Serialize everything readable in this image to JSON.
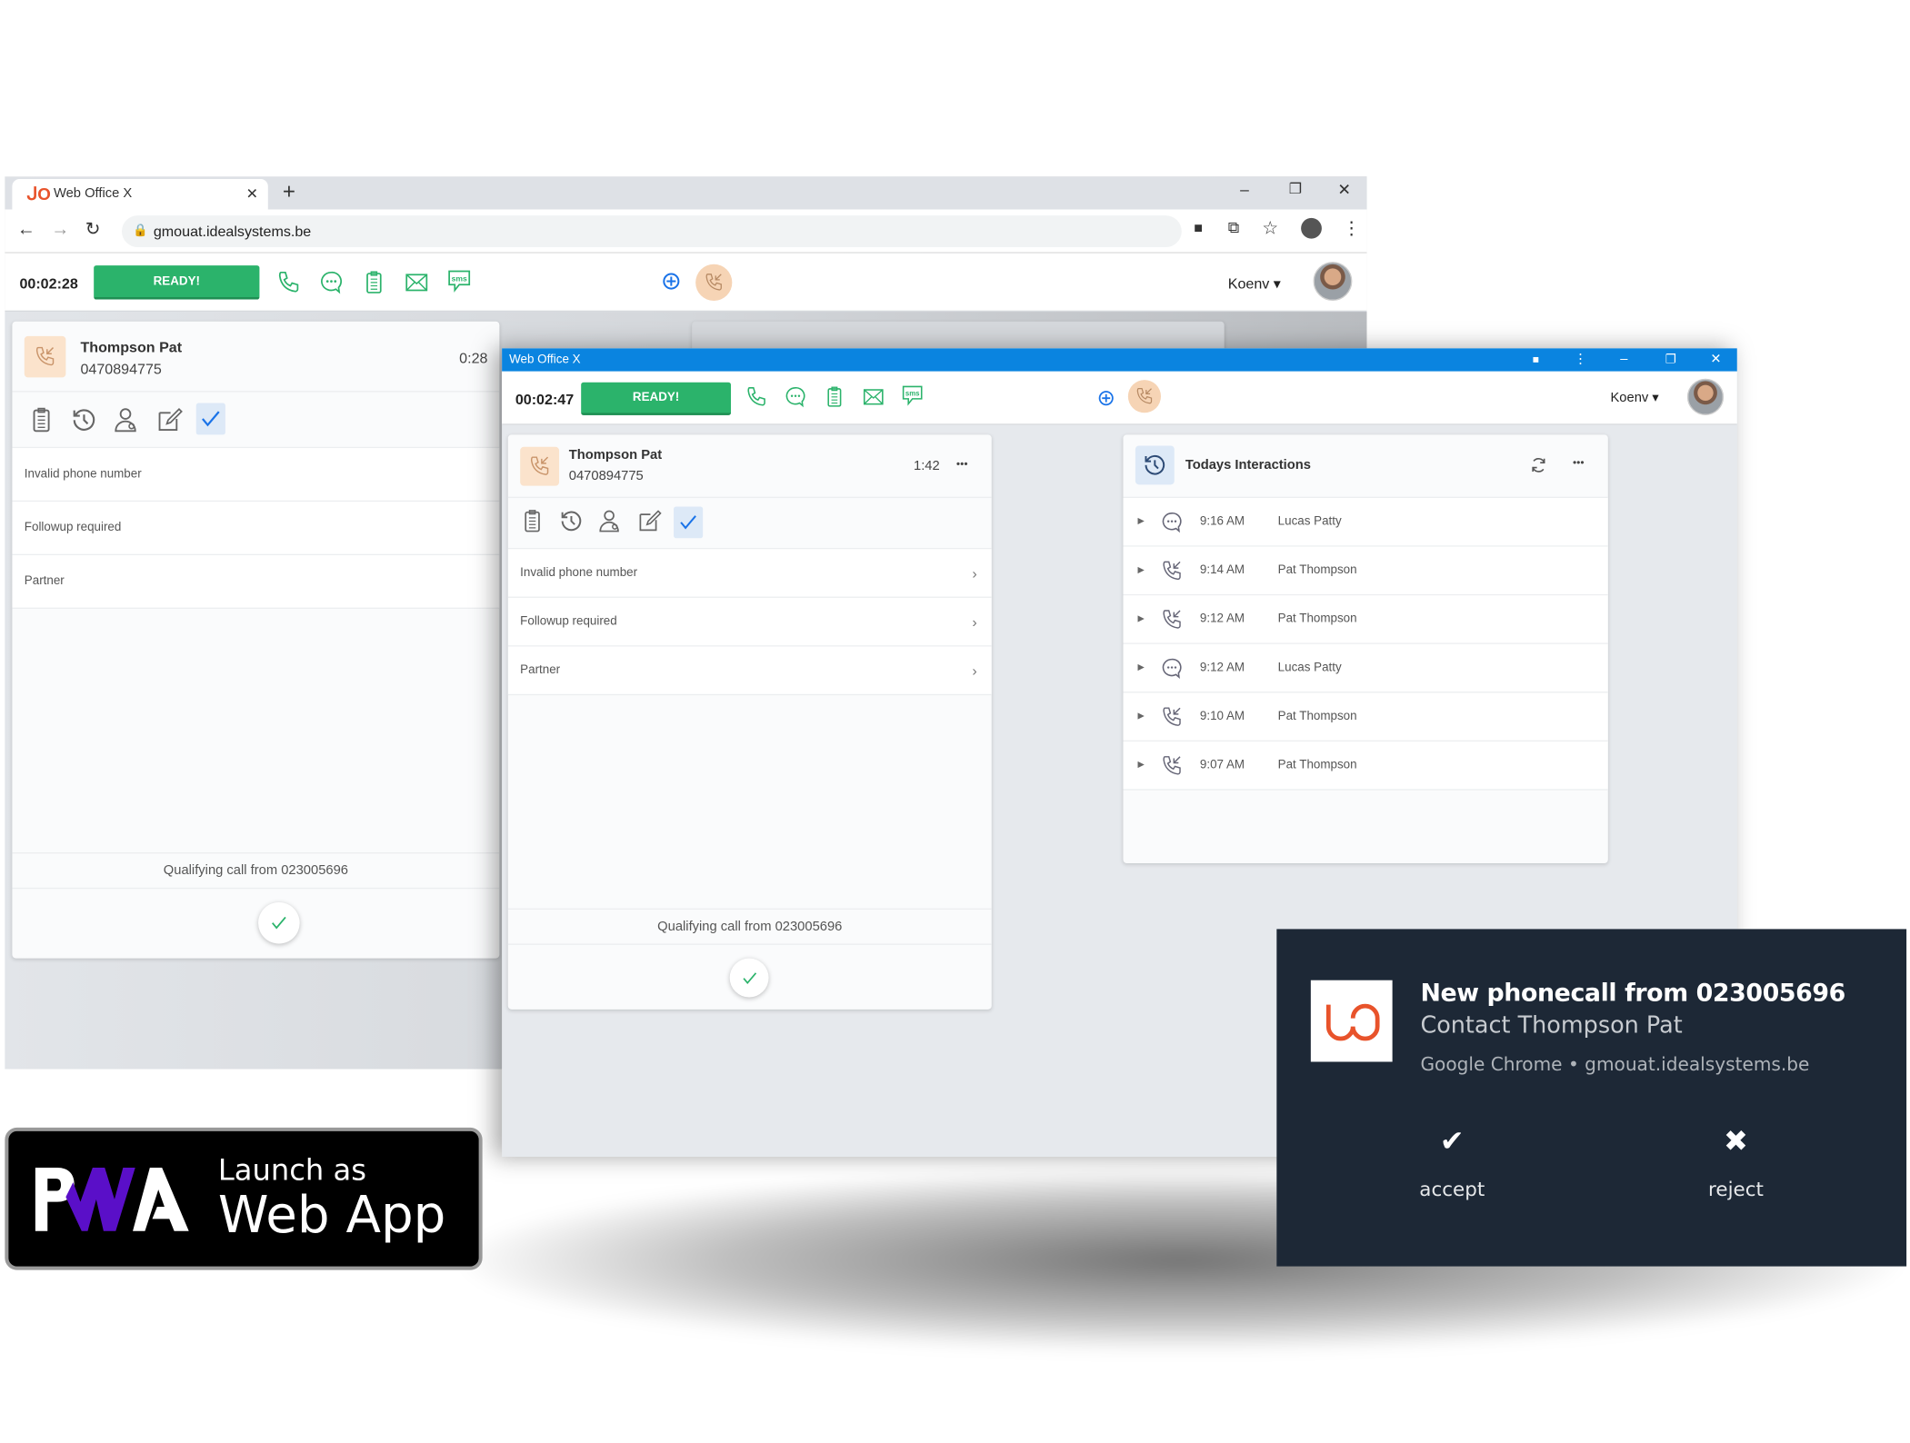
{
  "colors": {
    "ready_green": "#2bb36b",
    "titlebar_blue": "#0a84e0",
    "contact_peach": "#fbe3cc",
    "notification_bg": "#1d2836",
    "brand_orange": "#e8532b",
    "pwa_purple": "#5a0fc8"
  },
  "browser": {
    "tab_title": "Web Office X",
    "new_tab": "+",
    "url": "gmouat.idealsystems.be",
    "window_controls": {
      "minimize": "–",
      "restore": "❐",
      "close": "✕"
    }
  },
  "back_app": {
    "timer": "00:02:28",
    "ready_label": "READY!",
    "user": "Koenv",
    "contact": {
      "name": "Thompson Pat",
      "number": "0470894775",
      "duration": "0:28"
    },
    "options": [
      "Invalid phone number",
      "Followup required",
      "Partner"
    ],
    "footer": "Qualifying call from 023005696"
  },
  "pwa_window": {
    "title": "Web Office X",
    "timer": "00:02:47",
    "ready_label": "READY!",
    "user": "Koenv",
    "contact": {
      "name": "Thompson Pat",
      "number": "0470894775",
      "duration": "1:42",
      "more": "•••"
    },
    "options": [
      "Invalid phone number",
      "Followup required",
      "Partner"
    ],
    "footer": "Qualifying call from 023005696",
    "interactions": {
      "title": "Todays Interactions",
      "more": "•••",
      "rows": [
        {
          "type": "chat",
          "icon": "chat-icon",
          "time": "9:16 AM",
          "name": "Lucas Patty"
        },
        {
          "type": "call",
          "icon": "incoming-call-icon",
          "time": "9:14 AM",
          "name": "Pat Thompson"
        },
        {
          "type": "call",
          "icon": "incoming-call-icon",
          "time": "9:12 AM",
          "name": "Pat Thompson"
        },
        {
          "type": "chat",
          "icon": "chat-icon",
          "time": "9:12 AM",
          "name": "Lucas Patty"
        },
        {
          "type": "call",
          "icon": "incoming-call-icon",
          "time": "9:10 AM",
          "name": "Pat Thompson"
        },
        {
          "type": "call",
          "icon": "incoming-call-icon",
          "time": "9:07 AM",
          "name": "Pat Thompson"
        }
      ]
    }
  },
  "notification": {
    "title": "New phonecall from 023005696",
    "body": "Contact Thompson Pat",
    "source": "Google Chrome • gmouat.idealsystems.be",
    "accept_label": "accept",
    "reject_label": "reject",
    "accept_icon": "✔",
    "reject_icon": "✖"
  },
  "pwa_badge": {
    "logo_text": "PWA",
    "line1": "Launch as",
    "line2": "Web App"
  }
}
